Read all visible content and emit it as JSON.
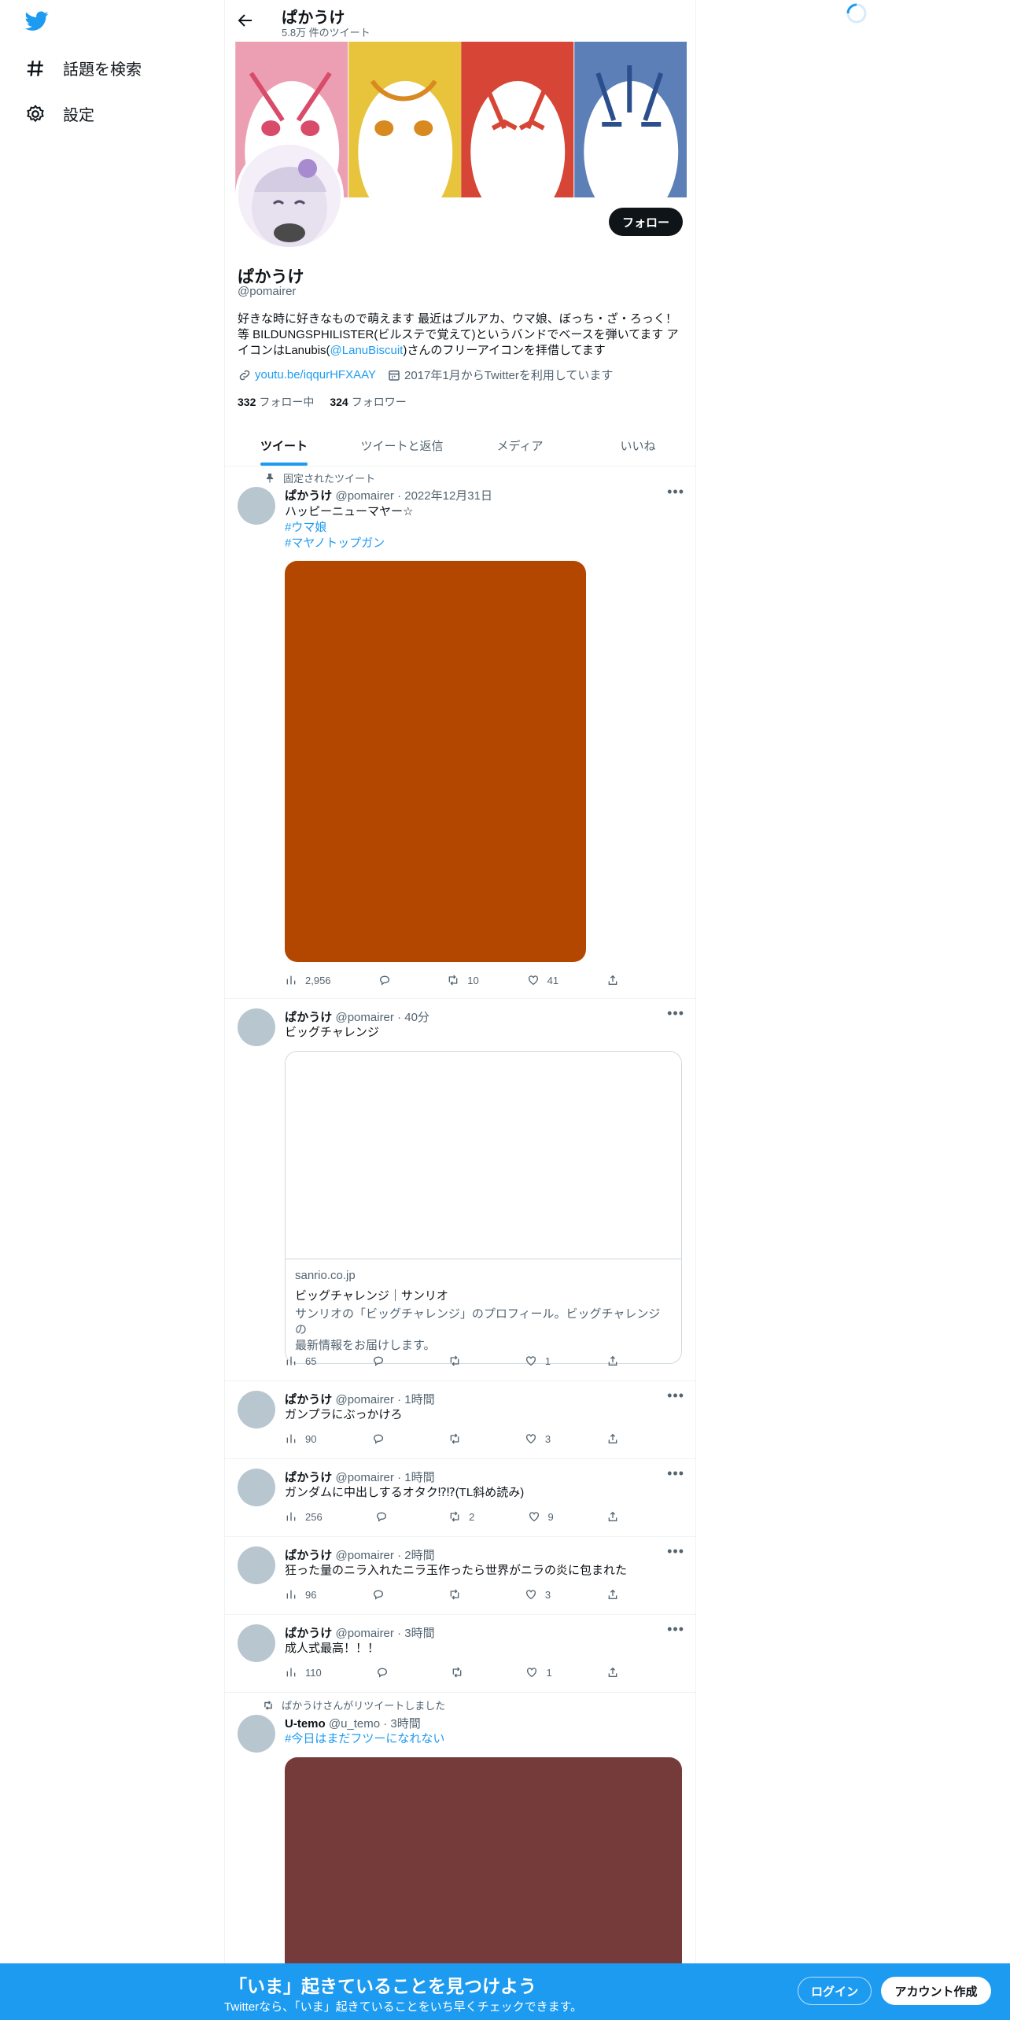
{
  "nav": {
    "items": [
      {
        "label": "話題を検索",
        "icon": "hashtag-icon"
      },
      {
        "label": "設定",
        "icon": "gear-icon"
      }
    ]
  },
  "header": {
    "name": "ぱかうけ",
    "tweet_count": "5.8万 件のツイート"
  },
  "profile": {
    "name": "ぱかうけ",
    "handle": "@pomairer",
    "follow_label": "フォロー",
    "bio_before": "好きな時に好きなもので萌えます 最近はブルアカ、ウマ娘、ぼっち・ざ・ろっく！等 BILDUNGSPHILISTER(ビルステで覚えて)というバンドでベースを弾いてます アイコンはLanubis(",
    "bio_mention": "@LanuBiscuit",
    "bio_after": ")さんのフリーアイコンを拝借してます",
    "link": "youtu.be/iqqurHFXAAY",
    "joined": "2017年1月からTwitterを利用しています",
    "following_count": "332",
    "following_label": "フォロー中",
    "followers_count": "324",
    "followers_label": "フォロワー"
  },
  "tabs": [
    "ツイート",
    "ツイートと返信",
    "メディア",
    "いいね"
  ],
  "colors": {
    "accent": "#1d9bf0",
    "media1": "#b34700",
    "media2": "#753b3b"
  },
  "tweets": [
    {
      "context": "固定されたツイート",
      "name": "ぱかうけ",
      "meta": "@pomairer · 2022年12月31日",
      "text": "ハッピーニューマヤー☆",
      "tags": [
        "#ウマ娘",
        "#マヤノトップガン"
      ],
      "views": "2,956",
      "replies": "",
      "retweets": "10",
      "likes": "41"
    },
    {
      "name": "ぱかうけ",
      "meta": "@pomairer · 40分",
      "text": "ビッグチャレンジ",
      "card": {
        "domain": "sanrio.co.jp",
        "title": "ビッグチャレンジ｜サンリオ",
        "desc1": "サンリオの「ビッグチャレンジ」のプロフィール。ビッグチャレンジの",
        "desc2": "最新情報をお届けします。"
      },
      "views": "65",
      "replies": "",
      "retweets": "",
      "likes": "1"
    },
    {
      "name": "ぱかうけ",
      "meta": "@pomairer · 1時間",
      "text": "ガンプラにぶっかけろ",
      "views": "90",
      "replies": "",
      "retweets": "",
      "likes": "3"
    },
    {
      "name": "ぱかうけ",
      "meta": "@pomairer · 1時間",
      "text": "ガンダムに中出しするオタク⁉⁉(TL斜め読み)",
      "views": "256",
      "replies": "",
      "retweets": "2",
      "likes": "9"
    },
    {
      "name": "ぱかうけ",
      "meta": "@pomairer · 2時間",
      "text": "狂った量のニラ入れたニラ玉作ったら世界がニラの炎に包まれた",
      "views": "96",
      "replies": "",
      "retweets": "",
      "likes": "3"
    },
    {
      "name": "ぱかうけ",
      "meta": "@pomairer · 3時間",
      "text": "成人式最高！！！",
      "views": "110",
      "replies": "",
      "retweets": "",
      "likes": "1"
    },
    {
      "context": "ぱかうけさんがリツイートしました",
      "name": "U-temo",
      "meta": "@u_temo · 3時間",
      "tags": [
        "#今日はまだフツーになれない"
      ]
    }
  ],
  "bottom_bar": {
    "title": "「いま」起きていることを見つけよう",
    "subtitle": "Twitterなら、「いま」起きていることをいち早くチェックできます。",
    "login": "ログイン",
    "signup": "アカウント作成"
  }
}
